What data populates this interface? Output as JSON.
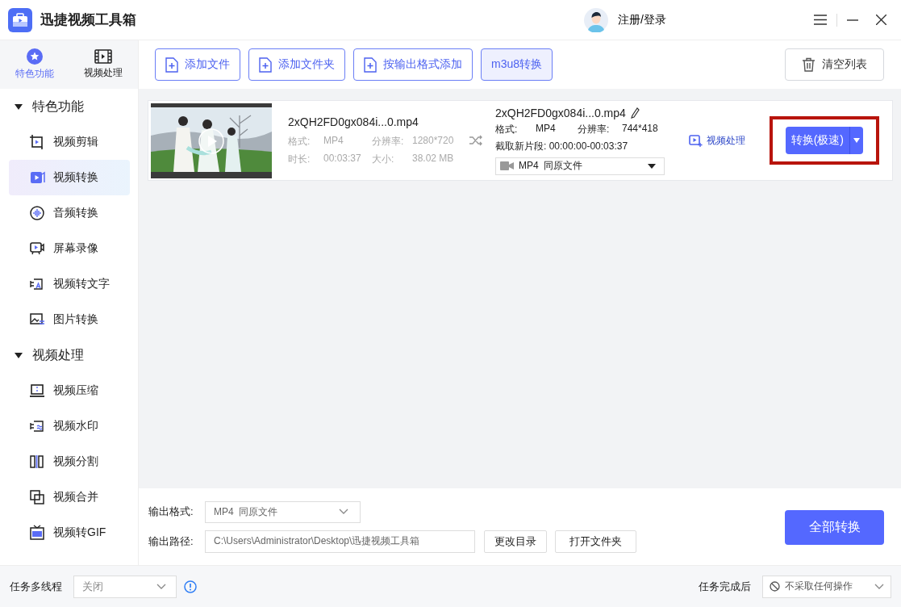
{
  "window": {
    "title": "迅捷视频工具箱"
  },
  "account": {
    "label": "注册/登录"
  },
  "sidebar": {
    "tabs": [
      {
        "label": "特色功能",
        "selected": true
      },
      {
        "label": "视频处理",
        "selected": false
      }
    ],
    "groups": [
      {
        "label": "特色功能",
        "expanded": true,
        "items": [
          {
            "label": "视频剪辑",
            "selected": false
          },
          {
            "label": "视频转换",
            "selected": true
          },
          {
            "label": "音频转换",
            "selected": false
          },
          {
            "label": "屏幕录像",
            "selected": false
          },
          {
            "label": "视频转文字",
            "selected": false
          },
          {
            "label": "图片转换",
            "selected": false
          }
        ]
      },
      {
        "label": "视频处理",
        "expanded": true,
        "items": [
          {
            "label": "视频压缩",
            "selected": false
          },
          {
            "label": "视频水印",
            "selected": false
          },
          {
            "label": "视频分割",
            "selected": false
          },
          {
            "label": "视频合并",
            "selected": false
          },
          {
            "label": "视频转GIF",
            "selected": false
          }
        ]
      }
    ]
  },
  "toolbar": {
    "buttons": [
      {
        "label": "添加文件",
        "kind": "add",
        "selected": false
      },
      {
        "label": "添加文件夹",
        "kind": "add",
        "selected": false
      },
      {
        "label": "按输出格式添加",
        "kind": "add",
        "selected": false
      },
      {
        "label": "m3u8转换",
        "kind": "plain",
        "selected": true
      }
    ],
    "clear_button": "清空列表"
  },
  "files": [
    {
      "thumbnail": {
        "kind": "picture"
      },
      "name": "2xQH2FD0gx084i...0.mp4",
      "info": [
        {
          "label": "格式:",
          "value": "MP4"
        },
        {
          "label": "分辨率:",
          "value": "1280*720"
        },
        {
          "label": "时长:",
          "value": "00:03:37"
        },
        {
          "label": "大小:",
          "value": "38.02 MB"
        }
      ],
      "output": {
        "name": "2xQH2FD0gx084i...0.mp4",
        "info": [
          {
            "label": "格式:",
            "value": "MP4"
          },
          {
            "label": "分辨率:",
            "value": "744*418"
          }
        ],
        "clip_label": "截取新片段:",
        "clip": "00:00:00-00:03:37",
        "format": "MP4",
        "format_note": "同原文件"
      },
      "process_link": "视频处理",
      "convert_button": "转换(极速)",
      "highlighted": true
    }
  ],
  "output": {
    "format_label": "输出格式:",
    "format": "MP4",
    "format_note": "同原文件",
    "path_label": "输出路径:",
    "path": "C:\\Users\\Administrator\\Desktop\\迅捷视频工具箱",
    "change_dir": "更改目录",
    "open_folder": "打开文件夹",
    "convert_all": "全部转换"
  },
  "status_bar": {
    "multithread_label": "任务多线程",
    "multithread": "关闭",
    "after_label": "任务完成后",
    "after": "不采取任何操作"
  }
}
